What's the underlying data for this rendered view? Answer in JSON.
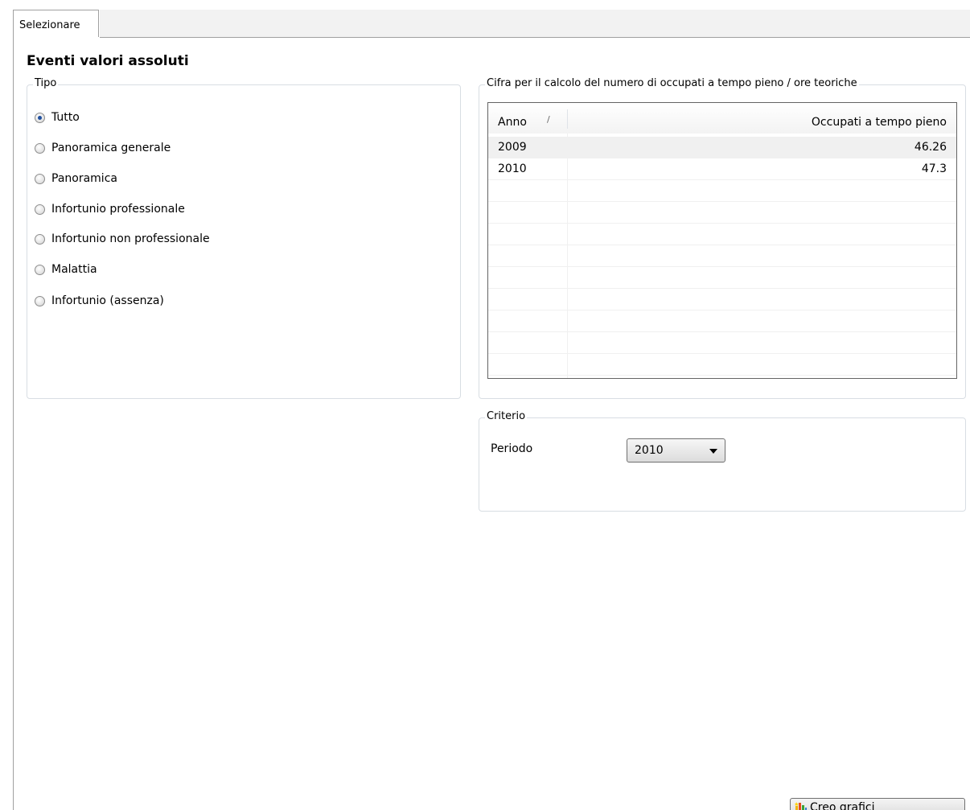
{
  "tabs": [
    {
      "label": "Selezionare"
    }
  ],
  "page_title": "Eventi valori assoluti",
  "tipo": {
    "legend": "Tipo",
    "options": [
      {
        "label": "Tutto",
        "checked": true
      },
      {
        "label": "Panoramica generale",
        "checked": false
      },
      {
        "label": "Panoramica",
        "checked": false
      },
      {
        "label": "Infortunio professionale",
        "checked": false
      },
      {
        "label": "Infortunio non professionale",
        "checked": false
      },
      {
        "label": "Malattia",
        "checked": false
      },
      {
        "label": "Infortunio (assenza)",
        "checked": false
      }
    ]
  },
  "cifra": {
    "legend": "Cifra per il calcolo del numero di occupati a tempo pieno / ore teoriche",
    "columns": [
      "Anno",
      "Occupati a tempo pieno"
    ],
    "sort_indicator": "/",
    "rows": [
      {
        "anno": "2009",
        "occupati": "46.26"
      },
      {
        "anno": "2010",
        "occupati": "47.3"
      }
    ]
  },
  "criterio": {
    "legend": "Criterio",
    "periodo_label": "Periodo",
    "periodo_value": "2010"
  },
  "button": {
    "label": "Creo grafici",
    "icon": "bar-chart-icon"
  }
}
